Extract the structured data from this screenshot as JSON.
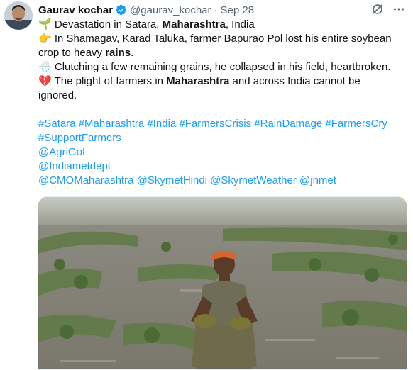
{
  "author": {
    "name": "Gaurav kochar",
    "handle": "@gaurav_kochar",
    "separator": "·",
    "date": "Sep 28"
  },
  "tweet": {
    "l1_emoji": "🌱",
    "l1_a": "Devastation in Satara, ",
    "l1_b": "Maharashtra",
    "l1_c": ", India",
    "l2_emoji": "👉",
    "l2_a": "In Shamagav, Karad Taluka, farmer Bapurao Pol lost his entire soybean",
    "l3_a": "crop to heavy ",
    "l3_b": "rains",
    "l3_c": ".",
    "l4_emoji": "🌧️",
    "l4_a": "Clutching a few remaining grains, he collapsed in his field, heartbroken.",
    "l5_emoji": "💔",
    "l5_a": "The plight of farmers in ",
    "l5_b": "Maharashtra",
    "l5_c": " and across India cannot be",
    "l6_a": "ignored.",
    "hashtags1": "#Satara #Maharashtra #India #FarmersCrisis #RainDamage #FarmersCry",
    "hashtags2": "#SupportFarmers",
    "mention1": "@AgriGoI",
    "mention2": "@Indiametdept",
    "mention3": "@CMOMaharashtra @SkymetHindi @SkymetWeather @jnmet"
  },
  "icons": {
    "verified": "verified-badge-icon",
    "grok": "grok-icon",
    "more": "more-options-icon"
  },
  "colors": {
    "link": "#1d9bf0",
    "secondary": "#536471",
    "text": "#0f1419"
  }
}
